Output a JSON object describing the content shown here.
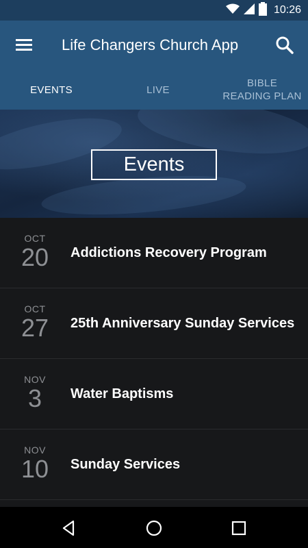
{
  "status_bar": {
    "time": "10:26",
    "icons": [
      "wifi-icon",
      "signal-icon",
      "battery-icon"
    ]
  },
  "app_bar": {
    "title": "Life Changers Church App",
    "menu_icon": "hamburger-menu-icon",
    "search_icon": "search-icon"
  },
  "tabs": [
    {
      "label": "EVENTS",
      "active": true
    },
    {
      "label": "LIVE",
      "active": false
    },
    {
      "label": "BIBLE\nREADING PLAN",
      "active": false
    }
  ],
  "hero": {
    "title": "Events"
  },
  "events": [
    {
      "month": "OCT",
      "day": "20",
      "title": "Addictions Recovery Program"
    },
    {
      "month": "OCT",
      "day": "27",
      "title": "25th Anniversary Sunday Services"
    },
    {
      "month": "NOV",
      "day": "3",
      "title": "Water Baptisms"
    },
    {
      "month": "NOV",
      "day": "10",
      "title": "Sunday Services"
    }
  ],
  "nav_bar": {
    "icons": [
      "back-icon",
      "home-icon",
      "recent-apps-icon"
    ]
  },
  "colors": {
    "primary": "#28567e",
    "status_bar": "#1d3e5e",
    "background": "#17181a",
    "date_text": "#8e9094"
  }
}
